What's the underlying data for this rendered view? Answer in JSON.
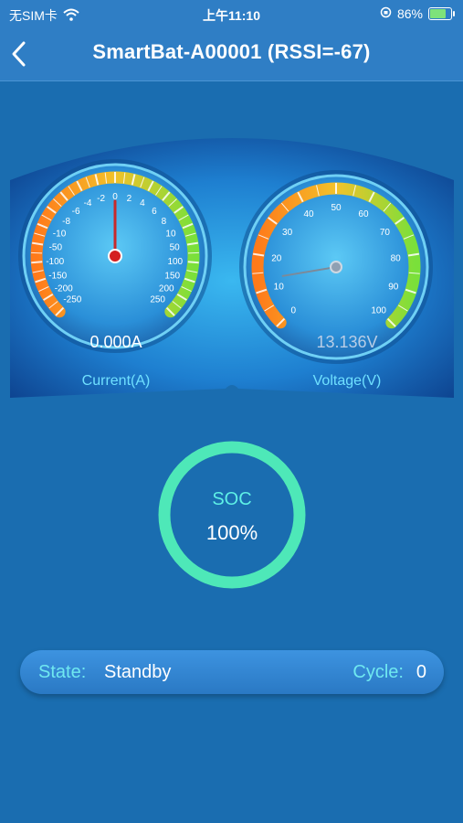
{
  "status": {
    "carrier": "无SIM卡",
    "time": "上午11:10",
    "battery_percent": "86%",
    "battery_level": 0.86
  },
  "nav": {
    "title": "SmartBat-A00001 (RSSI=-67)"
  },
  "gauges": {
    "current": {
      "reading": "0.000A",
      "title": "Current(A)",
      "ticks": [
        "-250",
        "-200",
        "-150",
        "-100",
        "-50",
        "-10",
        "-8",
        "-6",
        "-4",
        "-2",
        "0",
        "2",
        "4",
        "6",
        "8",
        "10",
        "50",
        "100",
        "150",
        "200",
        "250"
      ],
      "value_index": 10
    },
    "voltage": {
      "reading": "13.136V",
      "title": "Voltage(V)",
      "ticks": [
        "0",
        "10",
        "20",
        "30",
        "40",
        "50",
        "60",
        "70",
        "80",
        "90",
        "100"
      ],
      "value": 13.136
    }
  },
  "soc": {
    "label": "SOC",
    "value": "100%",
    "level": 1.0
  },
  "state": {
    "state_label": "State:",
    "state_value": "Standby",
    "cycle_label": "Cycle:",
    "cycle_value": "0"
  },
  "colors": {
    "background": "#1a6db0",
    "header": "#2f7ec5",
    "accent": "#6fe8f0",
    "soc_ring": "#4ee8b8"
  }
}
